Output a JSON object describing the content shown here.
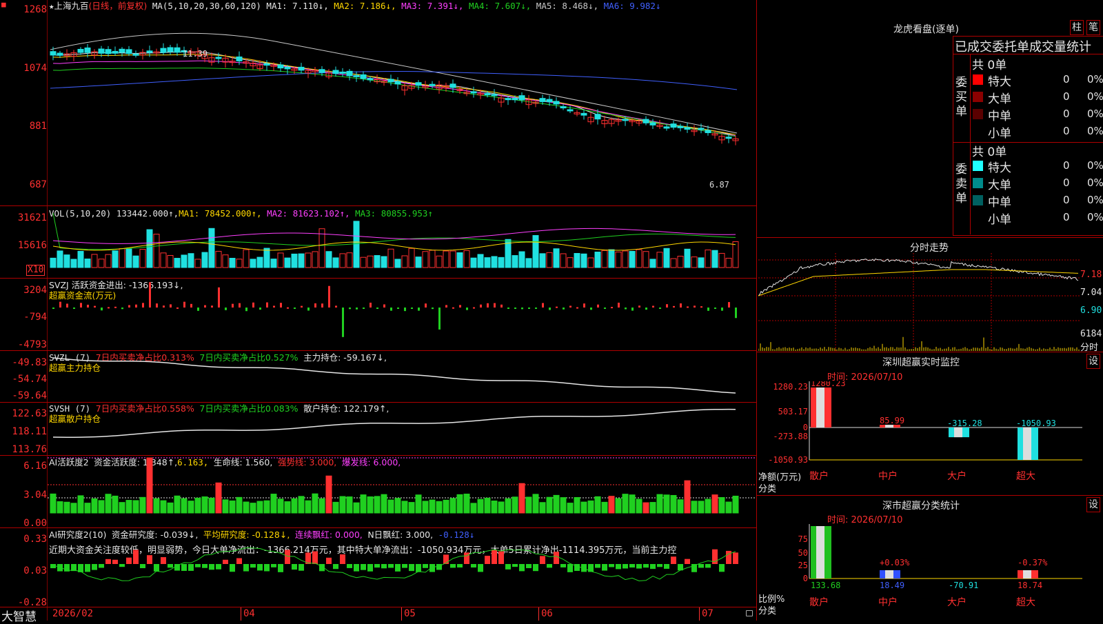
{
  "app": {
    "name": "大智慧"
  },
  "colors": {
    "up": "#ff3030",
    "down": "#20e0e0",
    "grid": "#b00000",
    "ma1": "#e6e6e6",
    "ma2": "#ffd700",
    "ma3": "#ff40ff",
    "ma4": "#20d020",
    "ma5": "#c8c8c8",
    "ma6": "#4060ff"
  },
  "main": {
    "star": "★",
    "stock_name": "上海九百",
    "period": "(日线，前复权)",
    "ma_legend": "MA(5,10,20,30,60,120)",
    "ma1": "MA1: 7.110↓,",
    "ma2": "MA2: 7.186↓,",
    "ma3": "MA3: 7.391↓,",
    "ma4": "MA4: 7.607↓,",
    "ma5": "MA5: 8.468↓,",
    "ma6": "MA6: 9.982↓",
    "y_labels": [
      "1268",
      "1074",
      "881",
      "687"
    ],
    "high_mark": "11.39",
    "low_mark": "6.87"
  },
  "vol": {
    "label": "VOL(5,10,20)",
    "value": "133442.000↑,",
    "ma1": "MA1: 78452.000↑,",
    "ma2": "MA2: 81623.102↑,",
    "ma3": "MA3: 80855.953↑",
    "y_labels": [
      "31621",
      "15616"
    ],
    "unit": "X10"
  },
  "svzj": {
    "label": "SVZJ  活跃资金进出: -1366.193↓,",
    "sub": "超赢资金流(万元)",
    "y_labels": [
      "3204",
      "-794",
      "-4793"
    ]
  },
  "svzl": {
    "label": "SVZL (7)",
    "p1": "7日内买卖净占比0.313%",
    "p2": "7日内买卖净占比0.527%",
    "p3": "主力持仓: -59.167↓,",
    "sub": "超赢主力持仓",
    "y_labels": [
      "-49.83",
      "-54.74",
      "-59.64"
    ]
  },
  "svsh": {
    "label": "SVSH (7)",
    "p1": "7日内买卖净占比0.558%",
    "p2": "7日内买卖净占比0.083%",
    "p3": "散户持仓: 122.179↑,",
    "sub": "超赢散户持仓",
    "y_labels": [
      "122.63",
      "118.11",
      "113.76"
    ]
  },
  "ai_active": {
    "label": "AI活跃度2",
    "p1": "资金活跃度: 1.348↑,",
    "p2": "6.163,",
    "p3": "生命线: 1.560,",
    "p4": "强势线: 3.000,",
    "p5": "爆发线: 6.000,",
    "y_labels": [
      "6.16",
      "3.04",
      "0.00"
    ]
  },
  "ai_research": {
    "label": "AI研究度2(10)",
    "p1": "资金研究度: -0.039↓,",
    "p2": "平均研究度: -0.128↓,",
    "p3": "连续飘红: 0.000,",
    "p4": "N日飘红: 3.000,",
    "p5": "-0.128↓",
    "comment": "近期大资金关注度较低，明显弱势，今日大单净流出：-1366.214万元，其中特大单净流出：-1050.934万元，大单5日累计净出-1114.395万元，当前主力控",
    "y_labels": [
      "0.33",
      "0.03",
      "-0.28"
    ]
  },
  "x_axis": [
    "2026/02",
    "04",
    "05",
    "06",
    "07"
  ],
  "right": {
    "lhb_title": "龙虎看盘(逐单)",
    "btn_zhu": "柱",
    "btn_bi": "笔",
    "table_header": "已成交委托单成交量统计",
    "buy_side": "委买单",
    "sell_side": "委卖单",
    "buy_total": "共 0单",
    "sell_total": "共 0单",
    "buy_rows": [
      {
        "label": "特大",
        "count": "0",
        "pct": "0%",
        "color": "#ff0000"
      },
      {
        "label": "大单",
        "count": "0",
        "pct": "0%",
        "color": "#8b0000"
      },
      {
        "label": "中单",
        "count": "0",
        "pct": "0%",
        "color": "#5a0000"
      },
      {
        "label": "小单",
        "count": "0",
        "pct": "0%",
        "color": ""
      }
    ],
    "sell_rows": [
      {
        "label": "特大",
        "count": "0",
        "pct": "0%",
        "color": "#20ffff"
      },
      {
        "label": "大单",
        "count": "0",
        "pct": "0%",
        "color": "#008b8b"
      },
      {
        "label": "中单",
        "count": "0",
        "pct": "0%",
        "color": "#006060"
      },
      {
        "label": "小单",
        "count": "0",
        "pct": "0%",
        "color": ""
      }
    ],
    "intraday_title": "分时走势",
    "intraday_prices": [
      "7.18",
      "7.04",
      "6.90"
    ],
    "intraday_vol": "6184",
    "intraday_vol_unit": "分时",
    "monitor": {
      "title": "深圳超赢实时监控",
      "btn": "设",
      "time": "时间: 2026/07/10",
      "y_labels": [
        "1280.23",
        "503.17",
        "0",
        "-273.88",
        "-1050.93"
      ],
      "y_unit": "净额(万元)",
      "x_unit": "分类",
      "bars": [
        {
          "cat": "散户",
          "value": 1280.23,
          "label": "1280.23"
        },
        {
          "cat": "中户",
          "value": 85.99,
          "label": "85.99"
        },
        {
          "cat": "大户",
          "value": -315.28,
          "label": "-315.28"
        },
        {
          "cat": "超大",
          "value": -1050.93,
          "label": "-1050.93"
        }
      ]
    },
    "classify": {
      "title": "深市超赢分类统计",
      "btn": "设",
      "time": "时间: 2026/07/10",
      "y_labels": [
        "75",
        "50",
        "25",
        "0"
      ],
      "y_unit": "比例%",
      "x_unit": "分类",
      "bars": [
        {
          "cat": "散户",
          "pct": 133.68,
          "label": "133.68",
          "change": ""
        },
        {
          "cat": "中户",
          "pct": 18.49,
          "label": "18.49",
          "change": "+0.03%"
        },
        {
          "cat": "大户",
          "pct": -70.91,
          "label": "-70.91",
          "change": ""
        },
        {
          "cat": "超大",
          "pct": 18.74,
          "label": "18.74",
          "change": "-0.37%"
        }
      ]
    }
  }
}
